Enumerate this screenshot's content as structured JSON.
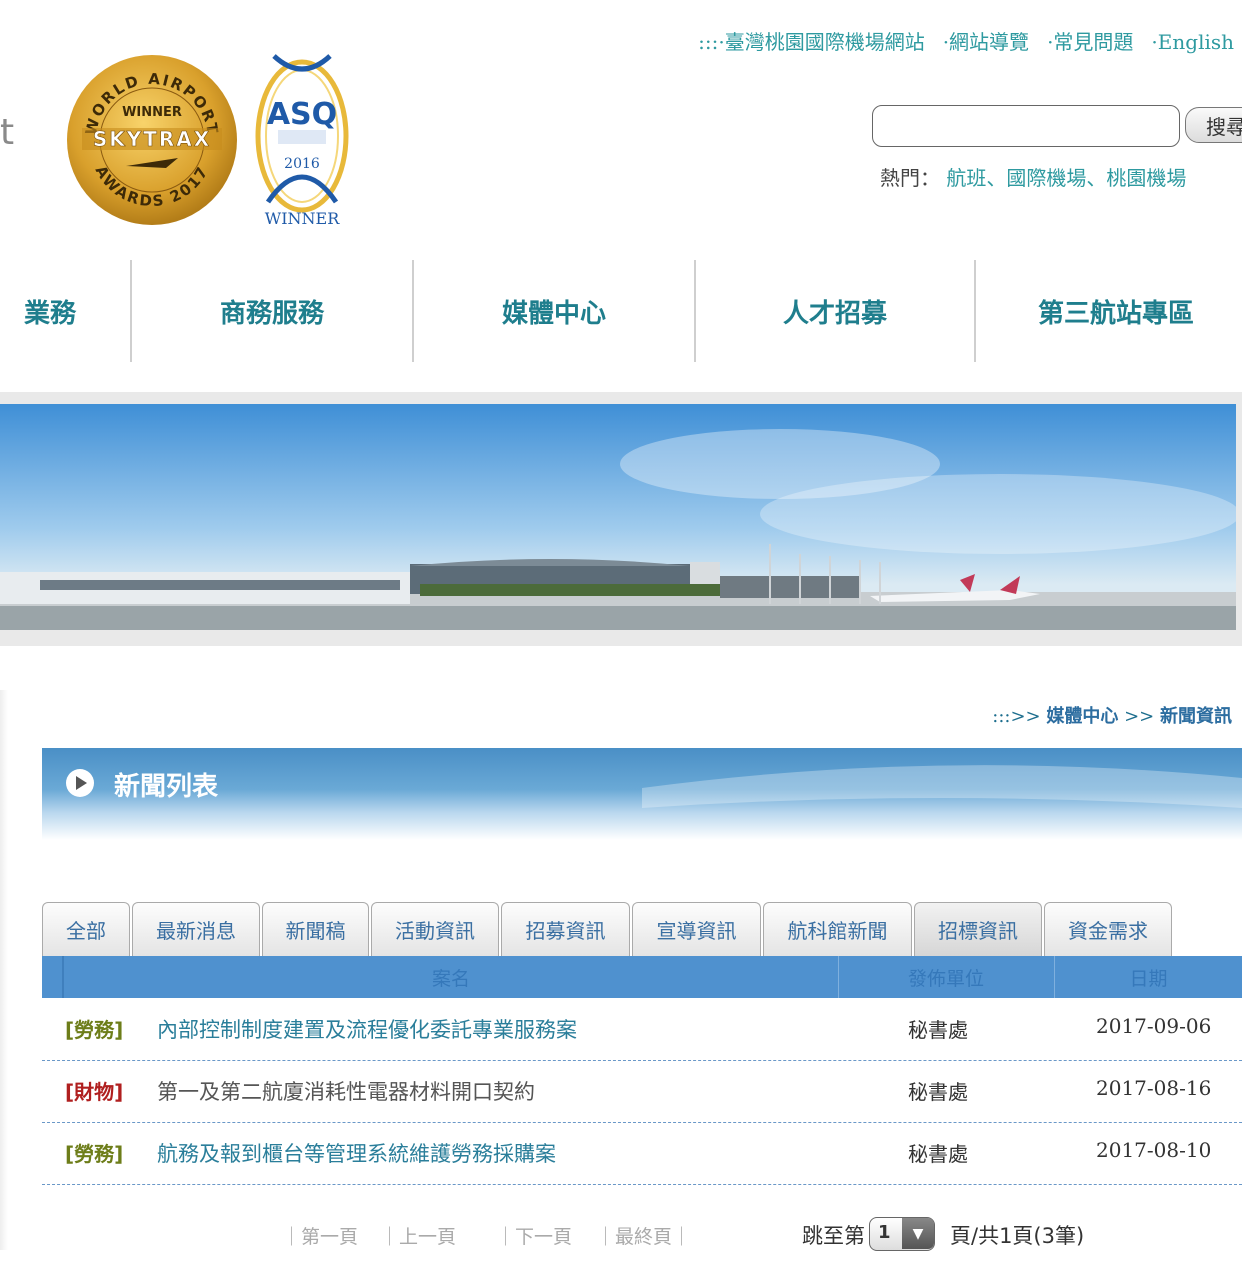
{
  "header": {
    "top_links": [
      ":::·臺灣桃園國際機場網站",
      "·網站導覽",
      "·常見問題",
      "·English"
    ],
    "logo_fragment": "t",
    "badges": {
      "skytrax": {
        "top": "WORLD AIRPORT",
        "winner": "WINNER",
        "brand": "SKYTRAX",
        "bottom": "AWARDS 2017"
      },
      "asq": {
        "brand": "ASQ",
        "year": "2016",
        "winner": "WINNER"
      }
    },
    "search": {
      "value": "",
      "button_label": "搜尋"
    },
    "hot": {
      "label": "熱門：",
      "terms": [
        "航班",
        "國際機場",
        "桃園機場"
      ],
      "separator": "、"
    }
  },
  "nav": {
    "items": [
      "業務",
      "商務服務",
      "媒體中心",
      "人才招募",
      "第三航站專區"
    ]
  },
  "breadcrumb": {
    "prefix": ":::>>",
    "items": [
      "媒體中心",
      "新聞資訊"
    ],
    "separator": ">>"
  },
  "section": {
    "title": "新聞列表"
  },
  "tabs": [
    "全部",
    "最新消息",
    "新聞稿",
    "活動資訊",
    "招募資訊",
    "宣導資訊",
    "航科館新聞",
    "招標資訊",
    "資金需求"
  ],
  "active_tab": "招標資訊",
  "table": {
    "headers": [
      "案名",
      "發佈單位",
      "日期"
    ],
    "rows": [
      {
        "tag": "[勞務]",
        "title": "內部控制制度建置及流程優化委託專業服務案",
        "unit": "秘書處",
        "date": "2017-09-06"
      },
      {
        "tag": "[財物]",
        "title": "第一及第二航廈消耗性電器材料開口契約",
        "unit": "秘書處",
        "date": "2017-08-16"
      },
      {
        "tag": "[勞務]",
        "title": "航務及報到櫃台等管理系統維護勞務採購案",
        "unit": "秘書處",
        "date": "2017-08-10"
      }
    ]
  },
  "pager": {
    "first": "｜第一頁",
    "prev": "｜上一頁",
    "next": "｜下一頁",
    "last": "｜最終頁｜",
    "jump_label": "跳至第",
    "page_value": "1",
    "page_info": "頁/共1頁(3筆)"
  },
  "colors": {
    "teal": "#2e9aa0",
    "nav_text": "#1f7e8d",
    "table_header": "#4f91cf",
    "labor_tag": "#6d7d19",
    "goods_tag": "#b01f1f"
  }
}
